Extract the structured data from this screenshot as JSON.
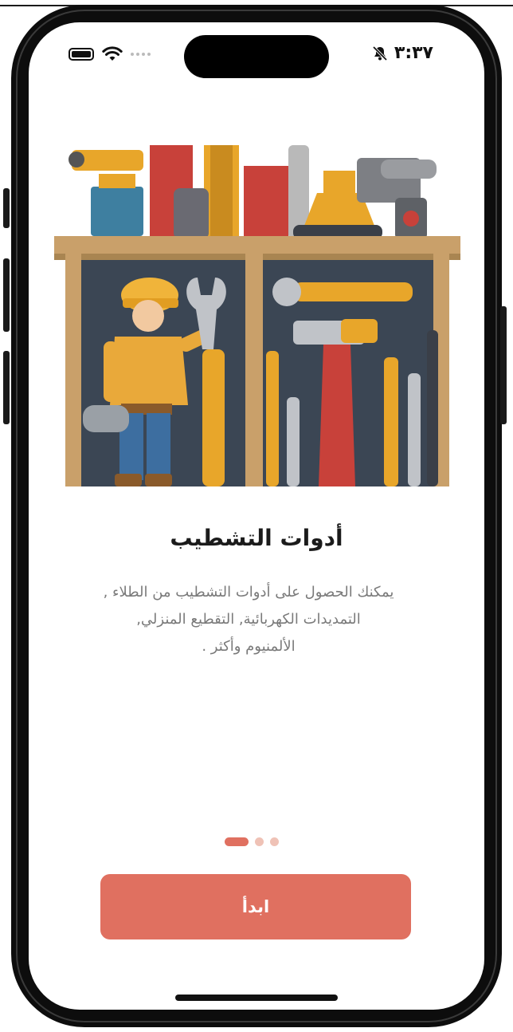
{
  "status_bar": {
    "time": "٣:٣٧",
    "battery_icon": "battery-icon",
    "wifi_icon": "wifi-icon",
    "signal_icon": "cellular-dots-icon",
    "bell_icon": "bell-slash-icon"
  },
  "onboarding": {
    "illustration": "worker-with-tools-illustration",
    "title": "أدوات التشطيب",
    "description_lines": [
      "يمكنك الحصول على أدوات التشطيب من الطلاء ,",
      "التمديدات الكهربائية, التقطيع المنزلي,",
      "الألمنيوم وأكثر ."
    ],
    "pager": {
      "pages": 3,
      "current": 1
    },
    "start_button_label": "ابدأ"
  },
  "colors": {
    "accent": "#e07060",
    "pager_inactive": "#efc2b6",
    "title": "#1b1b1b",
    "description": "#7a7a7a"
  }
}
